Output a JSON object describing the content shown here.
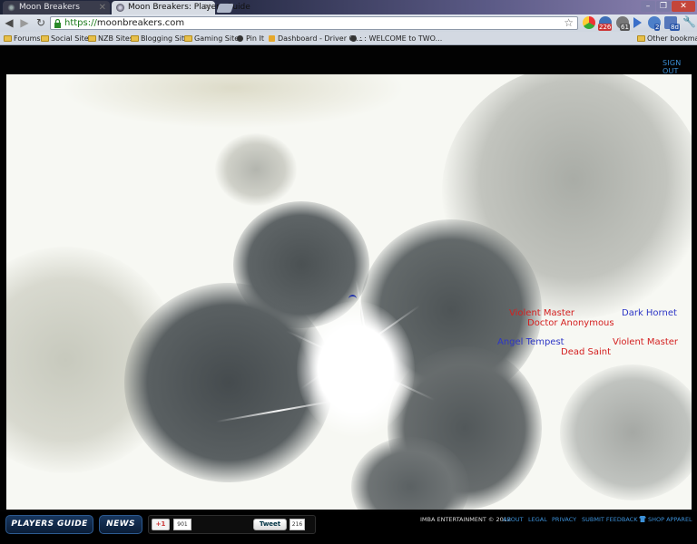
{
  "browser": {
    "tabs": [
      {
        "label": "Moon Breakers",
        "active": false
      },
      {
        "label": "Moon Breakers: Players Guide",
        "active": true
      }
    ],
    "url_secure": "https://",
    "url_host": "moonbreakers.com",
    "extensions": {
      "mail_count": "226",
      "gear_count": "61",
      "chat_count": "2",
      "cal_count": "8d"
    },
    "bookmarks": [
      "Forums",
      "Social Sites",
      "NZB Sites",
      "Blogging Sites",
      "Gaming Sites",
      "Pin It",
      "Dashboard - Driver Cl...",
      ": : WELCOME to TWO...",
      "Other bookmarks"
    ]
  },
  "header": {
    "sign_out_label": "SIGN OUT"
  },
  "game": {
    "players": {
      "left_team": [
        "Violent Master",
        "Doctor Anonymous",
        "Angel Tempest",
        "Dead Saint"
      ],
      "right_team": [
        "Dark Hornet",
        "Violent Master"
      ]
    },
    "colors": {
      "red_team": "#d42020",
      "blue_team": "#2d36c6"
    }
  },
  "footer": {
    "players_guide_label": "PLAYERS GUIDE",
    "news_label": "NEWS",
    "gplus_label": "+1",
    "gplus_count": "901",
    "tweet_label": "Tweet",
    "tweet_count": "216",
    "copyright": "IMBA ENTERTAINMENT © 2012",
    "links": [
      "ABOUT",
      "LEGAL",
      "PRIVACY",
      "SUBMIT FEEDBACK",
      "SHOP APPAREL"
    ]
  }
}
